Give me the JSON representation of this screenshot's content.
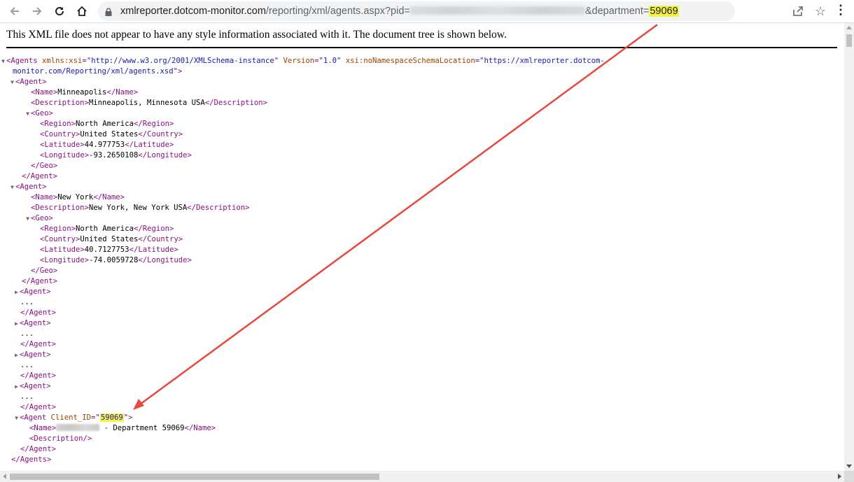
{
  "browser": {
    "url_prefix": "xmlreporter.dotcom-monitor.com",
    "url_path": "/reporting/xml/agents.aspx?pid=",
    "url_param_label": "&department=",
    "url_param_value": "59069",
    "icons": [
      "back-icon",
      "forward-icon",
      "reload-icon",
      "home-icon",
      "lock-icon",
      "share-icon",
      "star-icon",
      "menu-icon"
    ]
  },
  "notice": "This XML file does not appear to have any style information associated with it. The document tree is shown below.",
  "xml": {
    "root_open": "<Agents",
    "root_attr1_name": " xmlns:xsi",
    "root_attr1_value": "\"http://www.w3.org/2001/XMLSchema-instance\"",
    "root_attr2_name": " Version",
    "root_attr2_value": "\"1.0\"",
    "root_attr3_name": " xsi:noNamespaceSchemaLocation",
    "root_attr3_value_part1": "\"https://xmlreporter.dotcom-",
    "root_attr3_value_part2": "monitor.com/Reporting/xml/agents.xsd\"",
    "root_end": ">",
    "agent_open": "<Agent>",
    "agent_close": "</Agent>",
    "geo_open": "<Geo>",
    "geo_close": "</Geo>",
    "ellipsis": "...",
    "agents": [
      {
        "name": "Minneapolis",
        "description": "Minneapolis, Minnesota USA",
        "region": "North America",
        "country": "United States",
        "latitude": "44.977753",
        "longitude": "-93.2650108"
      },
      {
        "name": "New York",
        "description": "New York, New York USA",
        "region": "North America",
        "country": "United States",
        "latitude": "40.7127753",
        "longitude": "-74.0059728"
      }
    ],
    "client_agent": {
      "open": "<Agent",
      "attr_name": " Client_ID",
      "attr_value": "59069",
      "name_suffix": " - Department 59069",
      "description_empty": "<Description/>"
    },
    "root_close": "</Agents>"
  },
  "annotation": {
    "arrow_color": "#e8473d",
    "highlight_color": "#f4f14a"
  }
}
